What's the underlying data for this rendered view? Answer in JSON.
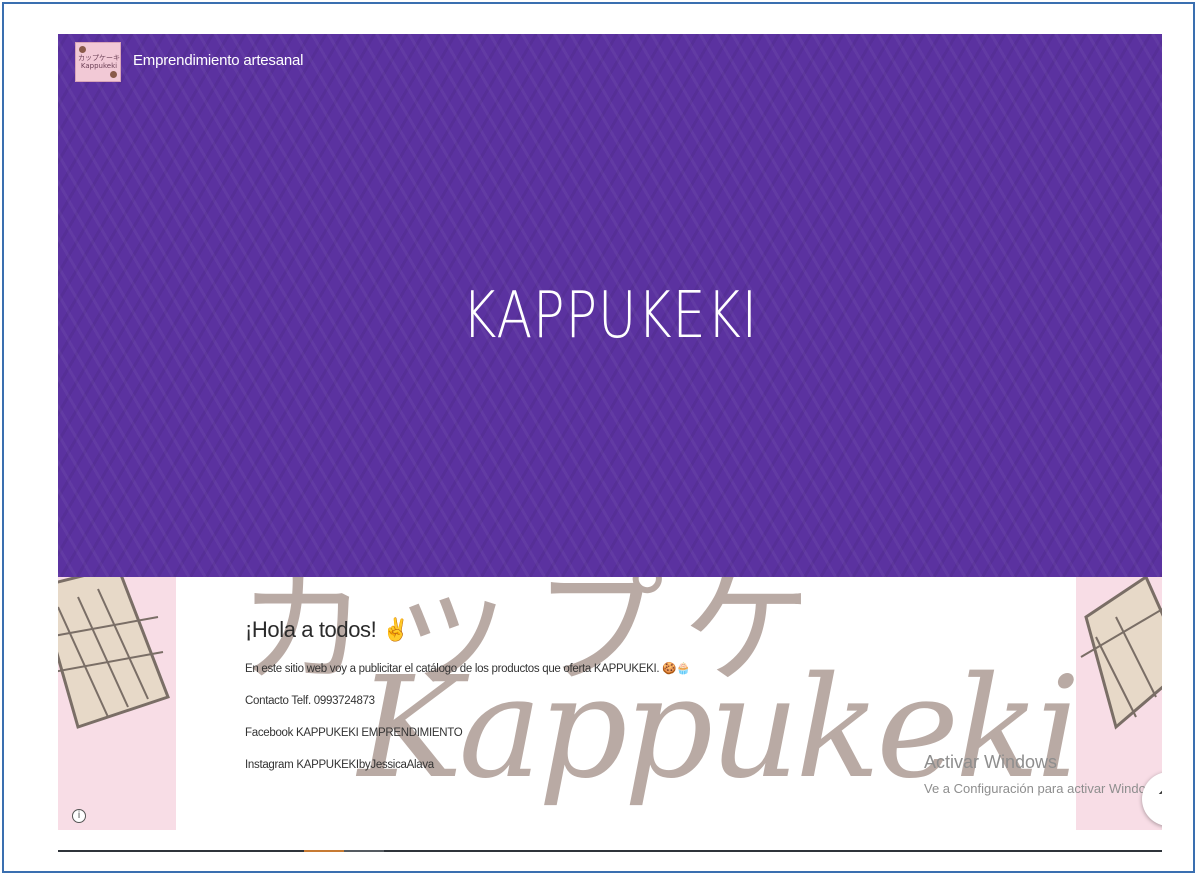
{
  "header": {
    "site_name": "Emprendimiento artesanal",
    "logo_text": "カップケーキ\nKappukeki"
  },
  "hero": {
    "title": "KAPPUKEKI",
    "background_color": "#5b32a0"
  },
  "content": {
    "greeting": "¡Hola a todos! ✌",
    "lines": [
      "En este sitio web voy a publicitar el catálogo de los productos que oferta KAPPUKEKI. 🍪🧁",
      "Contacto Telf. 0993724873",
      "Facebook KAPPUKEKI EMPRENDIMIENTO",
      "Instagram KAPPUKEKIbyJessicaAlava"
    ],
    "watermark_kana": "カップケ",
    "watermark_script": "Kappukeki"
  },
  "system": {
    "activate_title": "Activar Windows",
    "activate_subtitle": "Ve a Configuración para activar Windows.",
    "info_icon": "i",
    "scroll_icon": "^"
  }
}
